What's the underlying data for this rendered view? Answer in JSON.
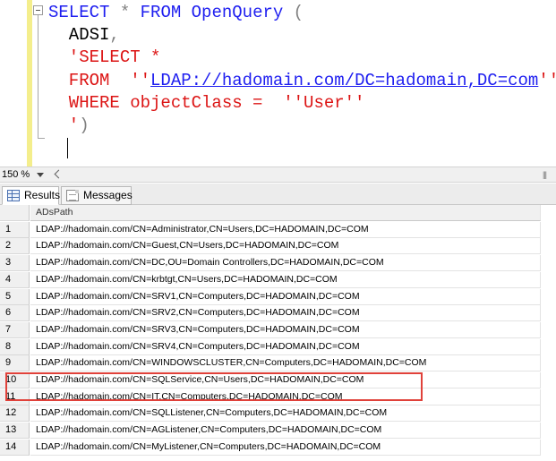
{
  "editor": {
    "lines": [
      [
        {
          "t": "SELECT",
          "c": "kw-blue"
        },
        {
          "t": " * ",
          "c": "kw-gray"
        },
        {
          "t": "FROM",
          "c": "kw-blue"
        },
        {
          "t": " ",
          "c": "kw-black"
        },
        {
          "t": "OpenQuery",
          "c": "kw-blue"
        },
        {
          "t": " (",
          "c": "kw-gray"
        }
      ],
      [
        {
          "t": "  ADSI",
          "c": "kw-black"
        },
        {
          "t": ",",
          "c": "kw-gray"
        }
      ],
      [
        {
          "t": "  'SELECT *",
          "c": "kw-red"
        }
      ],
      [
        {
          "t": "  FROM  ''",
          "c": "kw-red"
        },
        {
          "t": "LDAP://hadomain.com/DC=hadomain,DC=com",
          "c": "kw-link"
        },
        {
          "t": "''",
          "c": "kw-red"
        }
      ],
      [
        {
          "t": "  WHERE objectClass =  ''User''",
          "c": "kw-red"
        }
      ],
      [
        {
          "t": "  '",
          "c": "kw-red"
        },
        {
          "t": ")",
          "c": "kw-gray"
        }
      ]
    ]
  },
  "zoom": {
    "value": "150 %"
  },
  "tabs": {
    "results_label": "Results",
    "messages_label": "Messages"
  },
  "grid": {
    "column_header": "ADsPath",
    "rows": [
      {
        "num": "1",
        "path": "LDAP://hadomain.com/CN=Administrator,CN=Users,DC=HADOMAIN,DC=COM"
      },
      {
        "num": "2",
        "path": "LDAP://hadomain.com/CN=Guest,CN=Users,DC=HADOMAIN,DC=COM"
      },
      {
        "num": "3",
        "path": "LDAP://hadomain.com/CN=DC,OU=Domain Controllers,DC=HADOMAIN,DC=COM"
      },
      {
        "num": "4",
        "path": "LDAP://hadomain.com/CN=krbtgt,CN=Users,DC=HADOMAIN,DC=COM"
      },
      {
        "num": "5",
        "path": "LDAP://hadomain.com/CN=SRV1,CN=Computers,DC=HADOMAIN,DC=COM"
      },
      {
        "num": "6",
        "path": "LDAP://hadomain.com/CN=SRV2,CN=Computers,DC=HADOMAIN,DC=COM"
      },
      {
        "num": "7",
        "path": "LDAP://hadomain.com/CN=SRV3,CN=Computers,DC=HADOMAIN,DC=COM"
      },
      {
        "num": "8",
        "path": "LDAP://hadomain.com/CN=SRV4,CN=Computers,DC=HADOMAIN,DC=COM"
      },
      {
        "num": "9",
        "path": "LDAP://hadomain.com/CN=WINDOWSCLUSTER,CN=Computers,DC=HADOMAIN,DC=COM"
      },
      {
        "num": "10",
        "path": "LDAP://hadomain.com/CN=SQLService,CN=Users,DC=HADOMAIN,DC=COM"
      },
      {
        "num": "11",
        "path": "LDAP://hadomain.com/CN=IT,CN=Computers,DC=HADOMAIN,DC=COM"
      },
      {
        "num": "12",
        "path": "LDAP://hadomain.com/CN=SQLListener,CN=Computers,DC=HADOMAIN,DC=COM"
      },
      {
        "num": "13",
        "path": "LDAP://hadomain.com/CN=AGListener,CN=Computers,DC=HADOMAIN,DC=COM"
      },
      {
        "num": "14",
        "path": "LDAP://hadomain.com/CN=MyListener,CN=Computers,DC=HADOMAIN,DC=COM"
      }
    ]
  },
  "colors": {
    "highlight": "#e0413a",
    "keyword": "#1e1ef0",
    "string": "#dc1414"
  }
}
